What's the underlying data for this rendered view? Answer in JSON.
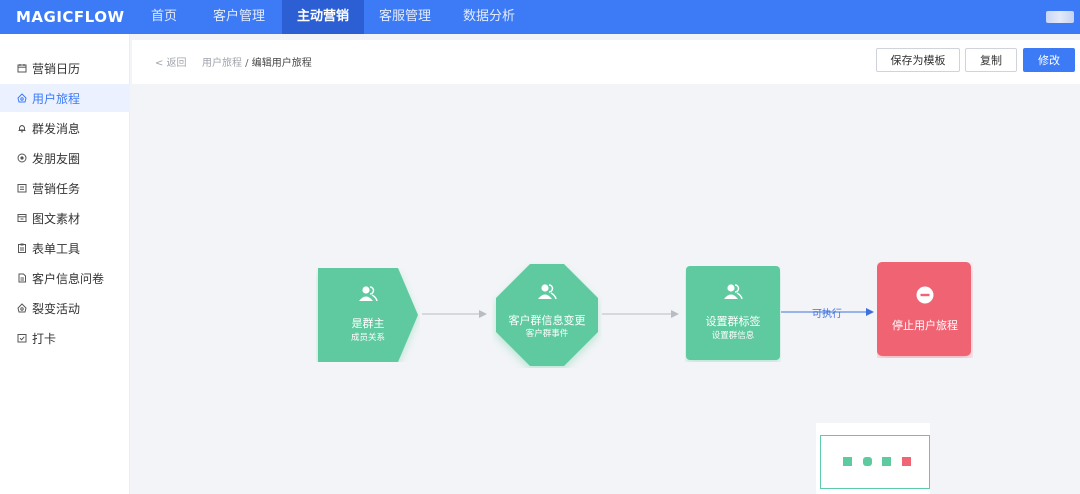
{
  "app": {
    "logo": "MAGICFLOW"
  },
  "topnav": {
    "items": [
      {
        "label": "首页"
      },
      {
        "label": "客户管理"
      },
      {
        "label": "主动营销"
      },
      {
        "label": "客服管理"
      },
      {
        "label": "数据分析"
      }
    ],
    "active_index": 2
  },
  "sidebar": {
    "items": [
      {
        "label": "营销日历",
        "icon": "calendar-icon"
      },
      {
        "label": "用户旅程",
        "icon": "journey-icon"
      },
      {
        "label": "群发消息",
        "icon": "bell-icon"
      },
      {
        "label": "发朋友圈",
        "icon": "moments-icon"
      },
      {
        "label": "营销任务",
        "icon": "task-icon"
      },
      {
        "label": "图文素材",
        "icon": "material-icon"
      },
      {
        "label": "表单工具",
        "icon": "form-icon"
      },
      {
        "label": "客户信息问卷",
        "icon": "survey-icon"
      },
      {
        "label": "裂变活动",
        "icon": "fission-icon"
      },
      {
        "label": "打卡",
        "icon": "checkin-icon"
      }
    ],
    "active_index": 1
  },
  "header": {
    "back_label": "< 返回",
    "breadcrumb_parent": "用户旅程",
    "breadcrumb_sep": " / ",
    "breadcrumb_current": "编辑用户旅程",
    "buttons": {
      "save_template": "保存为模板",
      "copy": "复制",
      "edit": "修改"
    }
  },
  "flow": {
    "nodes": [
      {
        "title": "是群主",
        "subtitle": "成员关系",
        "color": "#5ecaa0",
        "icon": "users-icon"
      },
      {
        "title": "客户群信息变更",
        "subtitle": "客户群事件",
        "color": "#5ecaa0",
        "icon": "users-icon"
      },
      {
        "title": "设置群标签",
        "subtitle": "设置群信息",
        "color": "#5ecaa0",
        "icon": "users-icon"
      },
      {
        "title": "停止用户旅程",
        "subtitle": "",
        "color": "#f06473",
        "icon": "stop-icon"
      }
    ],
    "edges": [
      {
        "label": ""
      },
      {
        "label": ""
      },
      {
        "label": "可执行"
      }
    ]
  },
  "colors": {
    "primary": "#3d7bf6",
    "nav_active": "#2d5fd4",
    "node_green": "#5ecaa0",
    "node_red": "#f06473",
    "edge_gray": "#b8bcc4",
    "edge_blue": "#3d6fe0"
  }
}
